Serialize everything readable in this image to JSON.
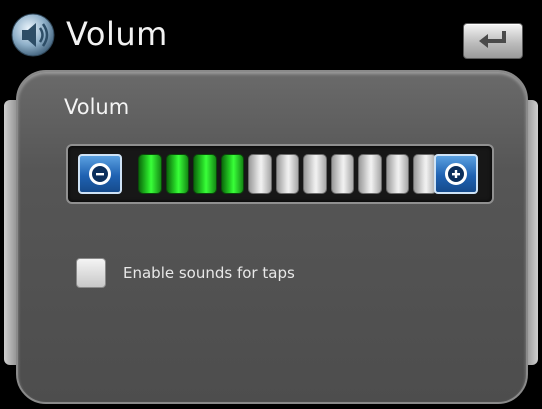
{
  "window": {
    "title": "Volum",
    "icon": "speaker-icon",
    "back_icon": "back-arrow-icon"
  },
  "panel": {
    "heading": "Volum"
  },
  "volume": {
    "level": 4,
    "max": 12,
    "decrease_icon": "minus-icon",
    "increase_icon": "plus-icon",
    "on_color": "#27d827",
    "off_color": "#e6e6e6",
    "button_color": "#1f62b2"
  },
  "sounds_option": {
    "label": "Enable sounds for taps",
    "checked": false
  }
}
